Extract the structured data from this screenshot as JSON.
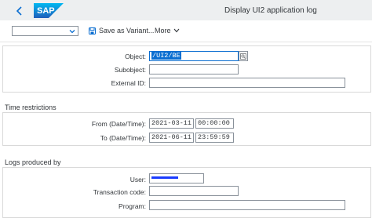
{
  "header": {
    "title": "Display UI2 application log",
    "logo_text": "SAP"
  },
  "toolbar": {
    "variant_value": "",
    "save_variant_label": "Save as Variant...",
    "more_label": "More"
  },
  "object_section": {
    "object_label": "Object:",
    "object_value": "/UI2/BE",
    "subobject_label": "Subobject:",
    "subobject_value": "",
    "external_id_label": "External ID:",
    "external_id_value": ""
  },
  "time_section": {
    "title": "Time restrictions",
    "from_label": "From (Date/Time):",
    "from_date": "2021-03-11",
    "from_time": "00:00:00",
    "to_label": "To (Date/Time):",
    "to_date": "2021-06-11",
    "to_time": "23:59:59"
  },
  "logs_section": {
    "title": "Logs produced by",
    "user_label": "User:",
    "transaction_label": "Transaction code:",
    "transaction_value": "",
    "program_label": "Program:",
    "program_value": ""
  },
  "colors": {
    "shell_bg": "#edeff0",
    "accent": "#0a6ed1",
    "redaction": "#1a3cff"
  }
}
